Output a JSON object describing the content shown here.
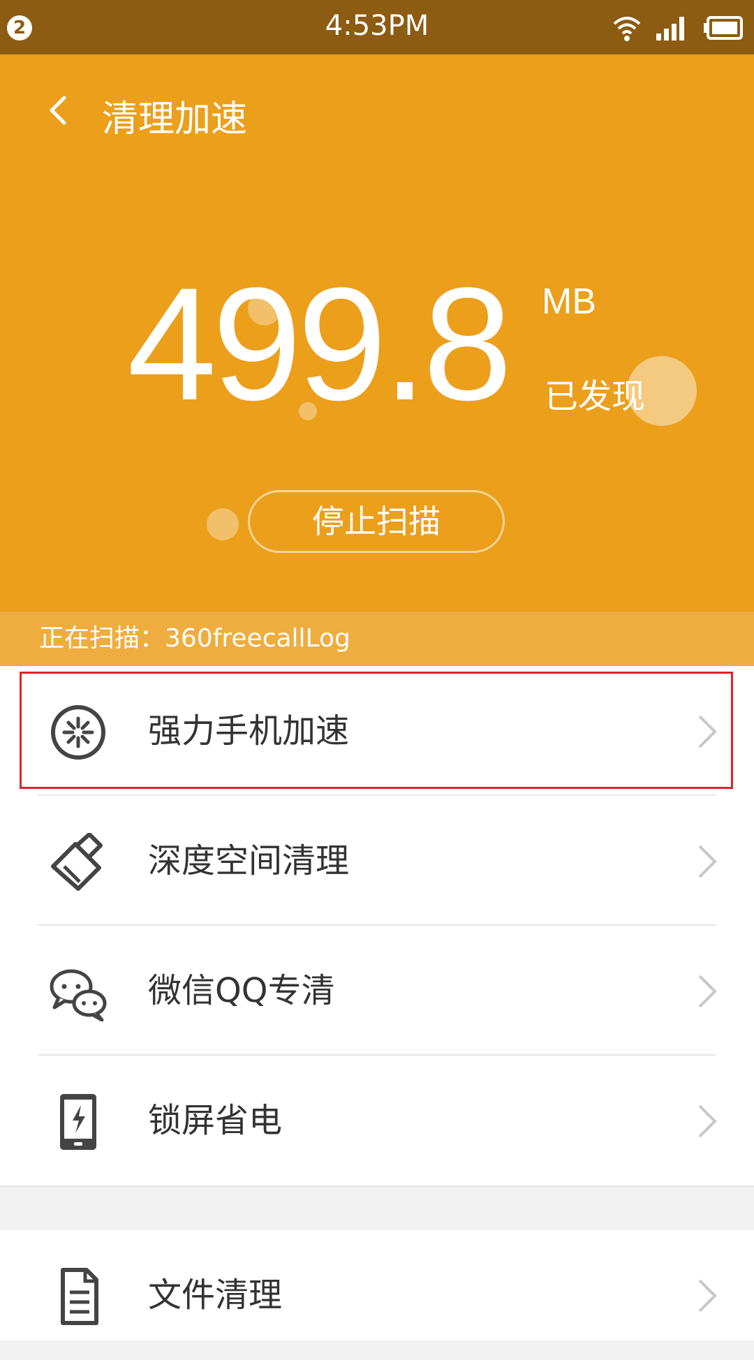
{
  "status_bar": {
    "notification_count": "2",
    "time": "4:53PM",
    "icons": [
      "wifi-icon",
      "signal-icon",
      "battery-icon"
    ]
  },
  "header": {
    "title": "清理加速",
    "back_icon": "back-arrow-icon"
  },
  "scan": {
    "size_value": "499.8",
    "size_unit": "MB",
    "found_label": "已发现",
    "stop_button": "停止扫描",
    "scanning_text": "正在扫描：360freecallLog"
  },
  "menu": {
    "items": [
      {
        "label": "强力手机加速",
        "icon": "boost-icon",
        "highlighted": true
      },
      {
        "label": "深度空间清理",
        "icon": "broom-icon"
      },
      {
        "label": "微信QQ专清",
        "icon": "chat-icon"
      },
      {
        "label": "锁屏省电",
        "icon": "lock-power-icon"
      }
    ],
    "items2": [
      {
        "label": "文件清理",
        "icon": "file-icon"
      }
    ]
  },
  "colors": {
    "status_bar": "#8c5c12",
    "hero": "#eb9f1b",
    "scan_bar": "#eead3e",
    "highlight": "#e0232c"
  }
}
